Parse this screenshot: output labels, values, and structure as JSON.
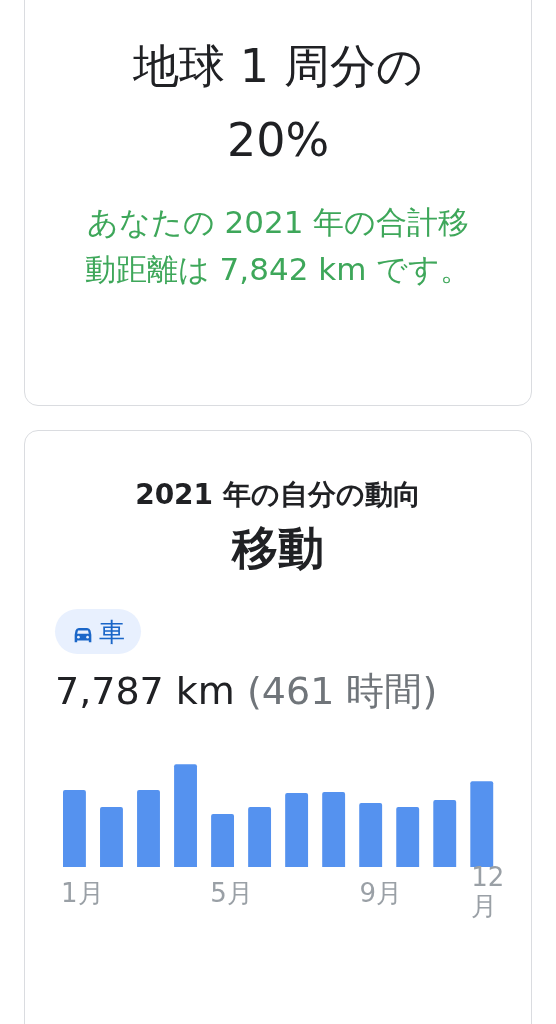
{
  "summary_card": {
    "headline": "地球 1 周分の 20%",
    "detail": "あなたの 2021 年の合計移動距離は 7,842 km です。"
  },
  "travel_card": {
    "subtitle": "2021 年の自分の動向",
    "title": "移動",
    "mode_chip": {
      "label": "車",
      "selected": true
    },
    "distance": "7,787 km",
    "duration": "(461 時間)",
    "month_labels": [
      "1月",
      "5月",
      "9月",
      "12月"
    ]
  }
}
